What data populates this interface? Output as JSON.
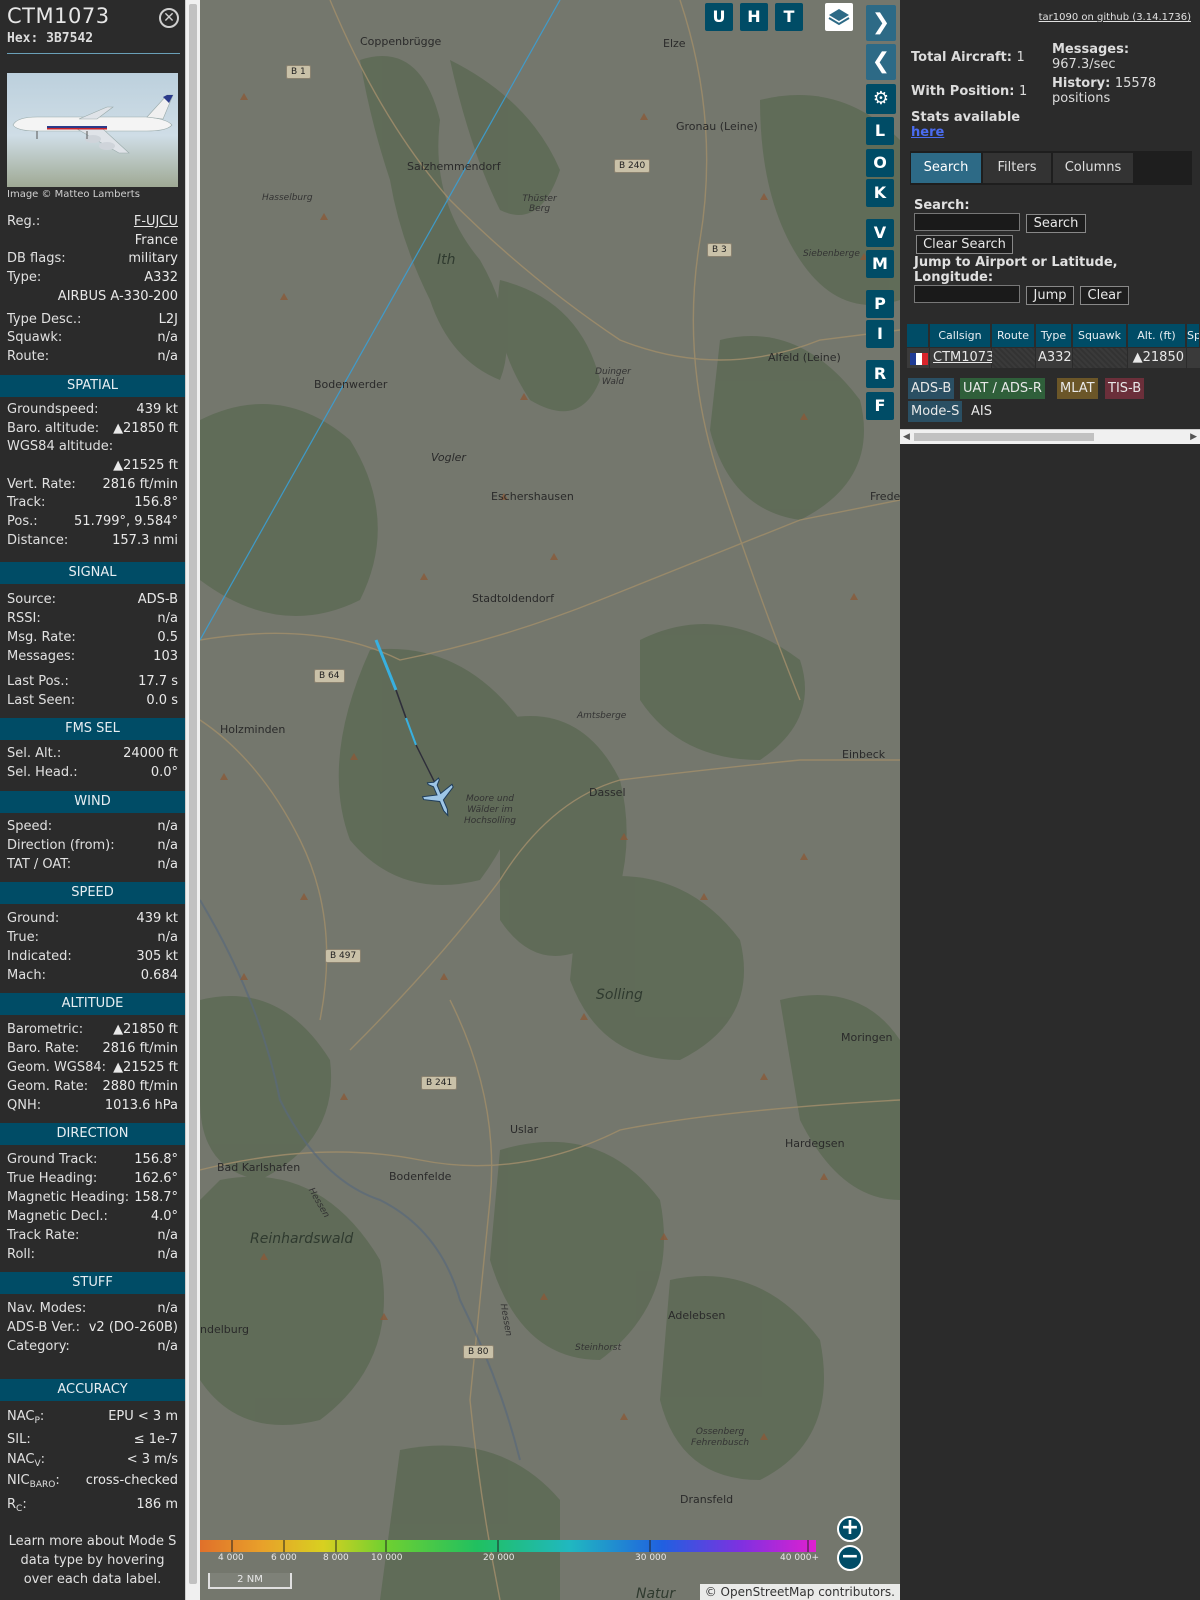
{
  "aircraft": {
    "callsign": "CTM1073",
    "hex_label": "Hex:",
    "hex": "3B7542",
    "photo_credit": "Image © Matteo Lamberts",
    "close_icon": "close-icon"
  },
  "details": [
    {
      "label": "Reg.:",
      "value": "F-UJCU"
    },
    {
      "label": "",
      "value": "France"
    },
    {
      "label": "DB flags:",
      "value": "military"
    },
    {
      "label": "Type:",
      "value": "A332"
    },
    {
      "label": "",
      "value": "AIRBUS A-330-200"
    },
    {
      "label": "Type Desc.:",
      "value": "L2J"
    },
    {
      "label": "Squawk:",
      "value": "n/a"
    },
    {
      "label": "Route:",
      "value": "n/a"
    }
  ],
  "sections": {
    "spatial": "SPATIAL",
    "signal": "SIGNAL",
    "fms": "FMS SEL",
    "wind": "WIND",
    "speed": "SPEED",
    "altitude": "ALTITUDE",
    "direction": "DIRECTION",
    "stuff": "STUFF",
    "accuracy": "ACCURACY"
  },
  "spatial": [
    {
      "label": "Groundspeed:",
      "value": "439 kt"
    },
    {
      "label": "Baro. altitude:",
      "value": "▲21850 ft"
    },
    {
      "label": "WGS84 altitude:",
      "value": ""
    },
    {
      "label": "",
      "value": "▲21525 ft"
    },
    {
      "label": "Vert. Rate:",
      "value": "2816 ft/min"
    },
    {
      "label": "Track:",
      "value": "156.8°"
    },
    {
      "label": "Pos.:",
      "value": "51.799°, 9.584°"
    },
    {
      "label": "Distance:",
      "value": "157.3 nmi"
    }
  ],
  "signal": [
    {
      "label": "Source:",
      "value": "ADS-B"
    },
    {
      "label": "RSSI:",
      "value": "n/a"
    },
    {
      "label": "Msg. Rate:",
      "value": "0.5"
    },
    {
      "label": "Messages:",
      "value": "103"
    },
    {
      "label": "Last Pos.:",
      "value": "17.7 s"
    },
    {
      "label": "Last Seen:",
      "value": "0.0 s"
    }
  ],
  "fms": [
    {
      "label": "Sel. Alt.:",
      "value": "24000 ft"
    },
    {
      "label": "Sel. Head.:",
      "value": "0.0°"
    }
  ],
  "wind": [
    {
      "label": "Speed:",
      "value": "n/a"
    },
    {
      "label": "Direction (from):",
      "value": "n/a"
    },
    {
      "label": "TAT / OAT:",
      "value": "n/a"
    }
  ],
  "speed": [
    {
      "label": "Ground:",
      "value": "439 kt"
    },
    {
      "label": "True:",
      "value": "n/a"
    },
    {
      "label": "Indicated:",
      "value": "305 kt"
    },
    {
      "label": "Mach:",
      "value": "0.684"
    }
  ],
  "altitude": [
    {
      "label": "Barometric:",
      "value": "▲21850 ft"
    },
    {
      "label": "Baro. Rate:",
      "value": "2816 ft/min"
    },
    {
      "label": "Geom. WGS84:",
      "value": "▲21525 ft"
    },
    {
      "label": "Geom. Rate:",
      "value": "2880 ft/min"
    },
    {
      "label": "QNH:",
      "value": "1013.6 hPa"
    }
  ],
  "direction": [
    {
      "label": "Ground Track:",
      "value": "156.8°"
    },
    {
      "label": "True Heading:",
      "value": "162.6°"
    },
    {
      "label": "Magnetic Heading:",
      "value": "158.7°"
    },
    {
      "label": "Magnetic Decl.:",
      "value": "4.0°"
    },
    {
      "label": "Track Rate:",
      "value": "n/a"
    },
    {
      "label": "Roll:",
      "value": "n/a"
    }
  ],
  "stuff": [
    {
      "label": "Nav. Modes:",
      "value": "n/a"
    },
    {
      "label": "ADS-B Ver.:",
      "value": "v2 (DO-260B)"
    },
    {
      "label": "Category:",
      "value": "n/a"
    }
  ],
  "accuracy": {
    "nacp_label": "NAC",
    "nacp_sub": "P",
    "nacp_value": "EPU < 3 m",
    "sil_label": "SIL:",
    "sil_value": "≤ 1e-7",
    "nacv_label": "NAC",
    "nacv_sub": "V",
    "nacv_value": "< 3 m/s",
    "nicbaro_label": "NIC",
    "nicbaro_sub": "BARO",
    "nicbaro_value": "cross-checked",
    "rc_label": "R",
    "rc_sub": "C",
    "rc_value": "186 m"
  },
  "note": "Learn more about Mode S data type by hovering over each data label.",
  "map": {
    "buttons": {
      "u": "U",
      "h": "H",
      "t": "T",
      "l": "L",
      "o": "O",
      "k": "K",
      "v": "V",
      "m": "M",
      "p": "P",
      "i": "I",
      "r": "R",
      "f": "F"
    },
    "places": [
      "Coppenbrügge",
      "Elze",
      "Gronau (Leine)",
      "Salzhemmendorf",
      "Hasselburg",
      "Thüster Berg",
      "Ith",
      "Siebenberge",
      "Alfeld (Leine)",
      "Duinger Wald",
      "Bodenwerder",
      "Vogler",
      "Eschershausen",
      "Frede",
      "Stadtoldendorf",
      "Amtsberge",
      "Holzminden",
      "Einbeck",
      "Dassel",
      "Moore und Wälder im Hochsolling",
      "Solling",
      "Moringen",
      "Uslar",
      "Hardegsen",
      "Bad Karlshafen",
      "Bodenfelde",
      "Hessen",
      "Reinhardswald",
      "Adelebsen",
      "ndelburg",
      "Steinhorst",
      "Hessen",
      "Ossenberg Fehrenbusch",
      "Dransfeld",
      "Natur"
    ],
    "roads": [
      "B 1",
      "B 240",
      "B 3",
      "B 64",
      "B 497",
      "B 241",
      "B 80"
    ],
    "altitude_scale": [
      "4 000",
      "6 000",
      "8 000",
      "10 000",
      "20 000",
      "30 000",
      "40 000+"
    ],
    "scale_label": "2 NM",
    "zoom_in": "+",
    "zoom_out": "−",
    "attribution_prefix": "© ",
    "attribution_link": "OpenStreetMap",
    "attribution_suffix": " contributors."
  },
  "sidebar": {
    "github": "tar1090 on github (3.14.1736)",
    "total_label": "Total Aircraft:",
    "total_value": "1",
    "messages_label": "Messages:",
    "messages_value": "967.3/sec",
    "withpos_label": "With Position:",
    "withpos_value": "1",
    "history_label": "History:",
    "history_value": "15578 positions",
    "stats_label": "Stats available",
    "stats_link": "here",
    "tabs": {
      "search": "Search",
      "filters": "Filters",
      "columns": "Columns"
    },
    "search_label": "Search:",
    "search_btn": "Search",
    "clear_search_btn": "Clear Search",
    "jump_label": "Jump to Airport or Latitude, Longitude:",
    "jump_btn": "Jump",
    "clear_btn": "Clear",
    "columns": [
      "Callsign",
      "Route",
      "Type",
      "Squawk",
      "Alt. (ft)",
      "Sp"
    ],
    "row": {
      "callsign": "CTM1073",
      "route": "",
      "type": "A332",
      "squawk": "",
      "alt": "▲21850"
    },
    "source_tags": [
      "ADS-B",
      "UAT / ADS-R",
      "MLAT",
      "TIS-B",
      "Mode-S",
      "AIS"
    ]
  },
  "colors": {
    "accent": "#004c66",
    "adsb": "#2a4f63",
    "uat": "#2f5f3a",
    "mlat": "#6b5628",
    "tisb": "#6b2f3a"
  }
}
